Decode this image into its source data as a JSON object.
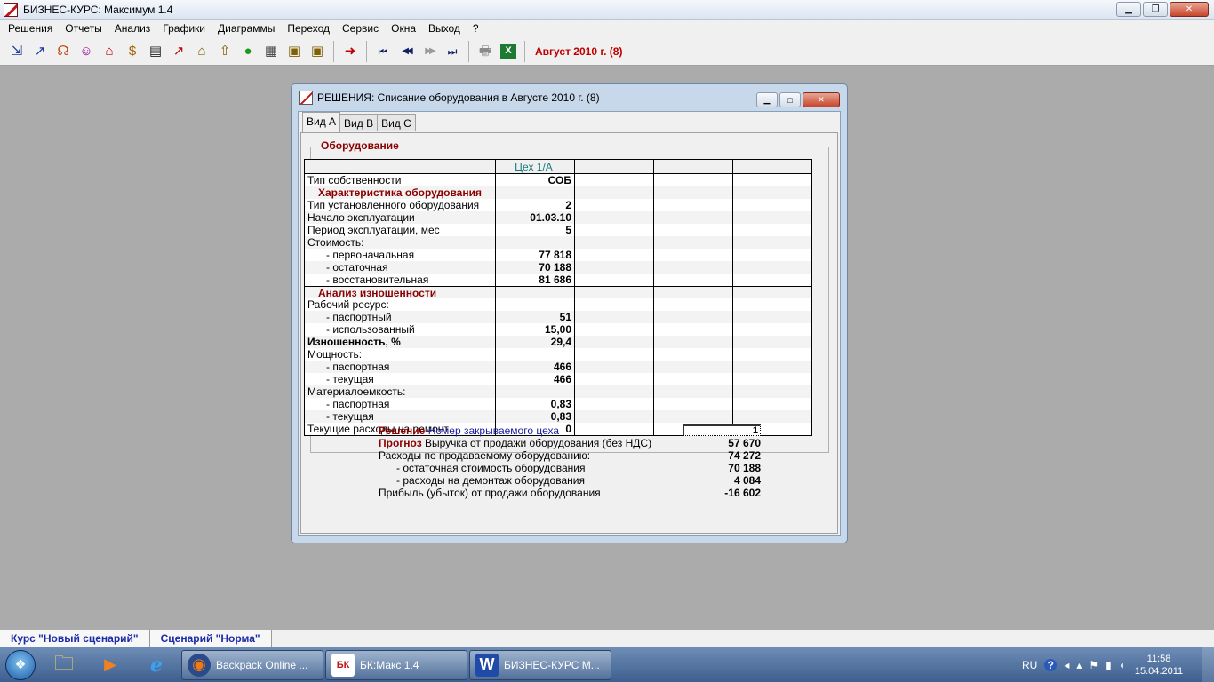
{
  "app": {
    "title": "БИЗНЕС-КУРС: Максимум 1.4",
    "window_controls": {
      "minimize": "▁",
      "restore": "❐",
      "close": "✕"
    }
  },
  "menu": [
    "Решения",
    "Отчеты",
    "Анализ",
    "Графики",
    "Диаграммы",
    "Переход",
    "Сервис",
    "Окна",
    "Выход",
    "?"
  ],
  "toolbar": {
    "icons": [
      "decisions-icon",
      "chart-up-icon",
      "people-icon",
      "team-icon",
      "house-icon",
      "money-icon",
      "table-icon",
      "trend-icon",
      "bank-icon",
      "bank-up-icon",
      "money-bag-icon",
      "document-icon",
      "print-preview-icon",
      "print-cash-icon"
    ],
    "glyphs": [
      "⇲",
      "↗",
      "☊",
      "☺",
      "⌂",
      "$",
      "▤",
      "↗",
      "⌂",
      "⇧",
      "●",
      "▦",
      "▣",
      "▣"
    ],
    "nav": {
      "goto": "➜",
      "first": "⏮",
      "prev": "◀◀",
      "next": "▶▶",
      "last": "⏭"
    },
    "print": "🖶",
    "excel": "X",
    "period_label": "Август 2010 г. (8)",
    "colors": {
      "period": "#c00000"
    }
  },
  "child_window": {
    "title": "РЕШЕНИЯ: Списание оборудования в Августе 2010 г. (8)",
    "controls": {
      "minimize": "▁",
      "restore": "□",
      "close": "✕"
    },
    "tabs": [
      "Вид А",
      "Вид В",
      "Вид С"
    ],
    "active_tab": 0,
    "group_title": "Оборудование",
    "grid": {
      "columns": [
        "",
        "Цех 1/А",
        "",
        "",
        ""
      ],
      "rows": [
        {
          "label": "Тип собственности",
          "value": "СОБ",
          "style": "normal"
        },
        {
          "label": "Характеристика оборудования",
          "value": "",
          "style": "section"
        },
        {
          "label": "Тип установленного оборудования",
          "value": "2",
          "style": "normal"
        },
        {
          "label": "Начало эксплуатации",
          "value": "01.03.10",
          "style": "normal"
        },
        {
          "label": "Период эксплуатации, мес",
          "value": "5",
          "style": "normal"
        },
        {
          "label": "Стоимость:",
          "value": "",
          "style": "normal"
        },
        {
          "label": "- первоначальная",
          "value": "77 818",
          "style": "indent"
        },
        {
          "label": "- остаточная",
          "value": "70 188",
          "style": "indent"
        },
        {
          "label": "- восстановительная",
          "value": "81 686",
          "style": "indent"
        },
        {
          "label": "Анализ изношенности",
          "value": "",
          "style": "section"
        },
        {
          "label": "Рабочий ресурс:",
          "value": "",
          "style": "normal"
        },
        {
          "label": "- паспортный",
          "value": "51",
          "style": "indent"
        },
        {
          "label": "- использованный",
          "value": "15,00",
          "style": "indent"
        },
        {
          "label": "Изношенность, %",
          "value": "29,4",
          "style": "bold"
        },
        {
          "label": "Мощность:",
          "value": "",
          "style": "normal"
        },
        {
          "label": "- паспортная",
          "value": "466",
          "style": "indent"
        },
        {
          "label": "- текущая",
          "value": "466",
          "style": "indent"
        },
        {
          "label": "Материалоемкость:",
          "value": "",
          "style": "normal"
        },
        {
          "label": "- паспортная",
          "value": "0,83",
          "style": "indent"
        },
        {
          "label": "- текущая",
          "value": "0,83",
          "style": "indent"
        },
        {
          "label": "Текущие расходы на ремонт",
          "value": "0",
          "style": "normal"
        }
      ]
    },
    "decision": {
      "label": "Решение",
      "field_label": "Номер закрываемого цеха",
      "field_value": "1"
    },
    "forecast": {
      "label": "Прогноз",
      "rows": [
        {
          "label": "Выручка от продажи оборудования (без НДС)",
          "value": "57 670",
          "indent": false
        },
        {
          "label": "Расходы по продаваемому оборудованию:",
          "value": "74 272",
          "indent": false
        },
        {
          "label": "- остаточная стоимость оборудования",
          "value": "70 188",
          "indent": true
        },
        {
          "label": "- расходы на демонтаж оборудования",
          "value": "4 084",
          "indent": true
        },
        {
          "label": "Прибыль (убыток) от продажи оборудования",
          "value": "-16 602",
          "indent": false
        }
      ]
    }
  },
  "status_tabs": [
    "Курс \"Новый сценарий\"",
    "Сценарий \"Норма\""
  ],
  "taskbar": {
    "start_glyph": "❖",
    "quick_launch": [
      {
        "icon": "folder-icon",
        "glyph": "🗀"
      },
      {
        "icon": "media-player-icon",
        "glyph": "▶"
      },
      {
        "icon": "ie-icon",
        "glyph": "e"
      }
    ],
    "buttons": [
      {
        "label": "Backpack Online ...",
        "icon": "firefox-icon",
        "glyph": "◉"
      },
      {
        "label": "БК:Макс 1.4",
        "icon": "bk-app-icon",
        "glyph": "БК"
      },
      {
        "label": "БИЗНЕС-КУРС М...",
        "icon": "word-icon",
        "glyph": "W"
      }
    ],
    "tray": {
      "lang": "RU",
      "help": "?",
      "icons": [
        "◂",
        "▴",
        "⚑",
        "▮",
        "◖"
      ],
      "time": "11:58",
      "date": "15.04.2011"
    }
  }
}
